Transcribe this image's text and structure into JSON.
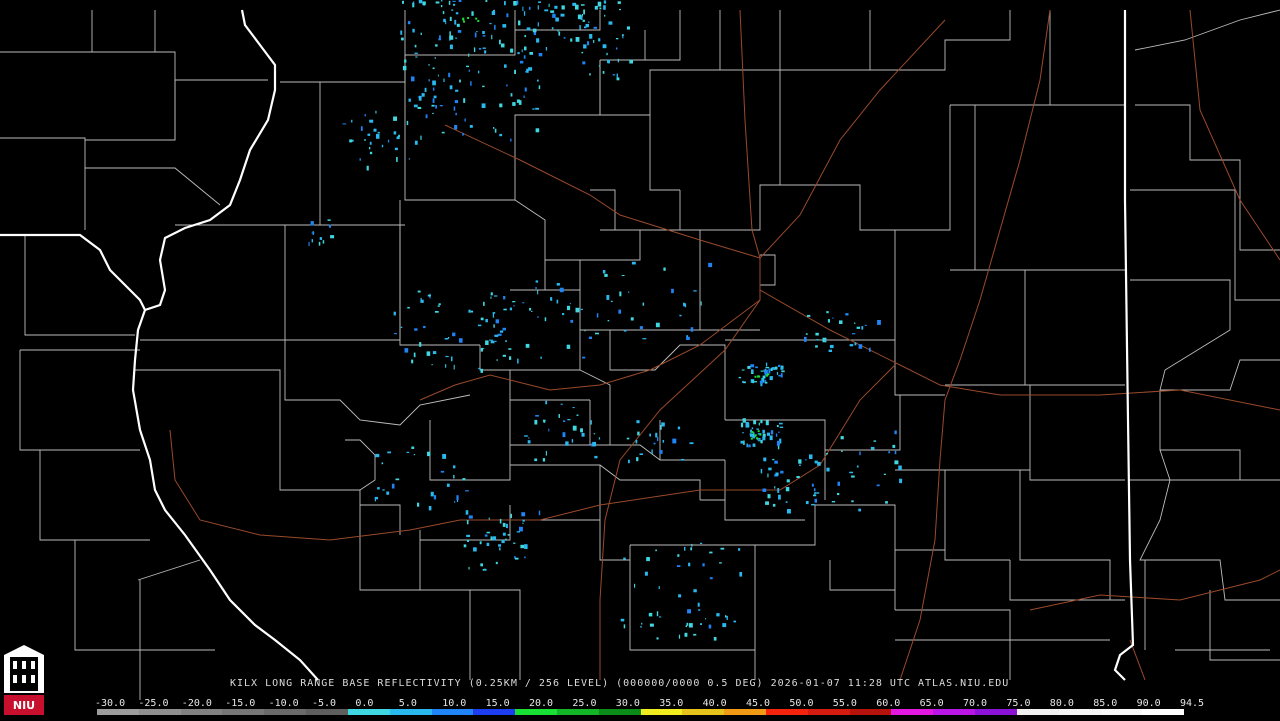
{
  "product": {
    "caption": "KILX LONG RANGE BASE REFLECTIVITY (0.25KM / 256 LEVEL) (000000/0000 0.5 DEG) 2026-01-07 11:28 UTC  ATLAS.NIU.EDU"
  },
  "logo": {
    "text": "NIU",
    "icon": "university-logo-icon"
  },
  "scale": {
    "labels": [
      "-30.0",
      "-25.0",
      "-20.0",
      "-15.0",
      "-10.0",
      "-5.0",
      "0.0",
      "5.0",
      "10.0",
      "15.0",
      "20.0",
      "25.0",
      "30.0",
      "35.0",
      "40.0",
      "45.0",
      "50.0",
      "55.0",
      "60.0",
      "65.0",
      "70.0",
      "75.0",
      "80.0",
      "85.0",
      "90.0",
      "94.5"
    ],
    "colors": [
      "#9c9c9c",
      "#8f8f8f",
      "#828282",
      "#767676",
      "#6a6a6a",
      "#5e5e5e",
      "#40d8e0",
      "#29b9ef",
      "#1f84f5",
      "#1c3ef0",
      "#19e035",
      "#12b526",
      "#0b8c18",
      "#f0ec20",
      "#e6c31a",
      "#f09a15",
      "#f5230c",
      "#d41b10",
      "#b5120c",
      "#e318e0",
      "#b815e6",
      "#8c12d8",
      "#f0f0f0",
      "#f4f4f4",
      "#f8f8f8",
      "#ffffff"
    ]
  },
  "colors": {
    "background": "#000000",
    "county_lines": "#bdbdbd",
    "state_lines": "#ffffff",
    "highways": "#9a4a2a"
  }
}
